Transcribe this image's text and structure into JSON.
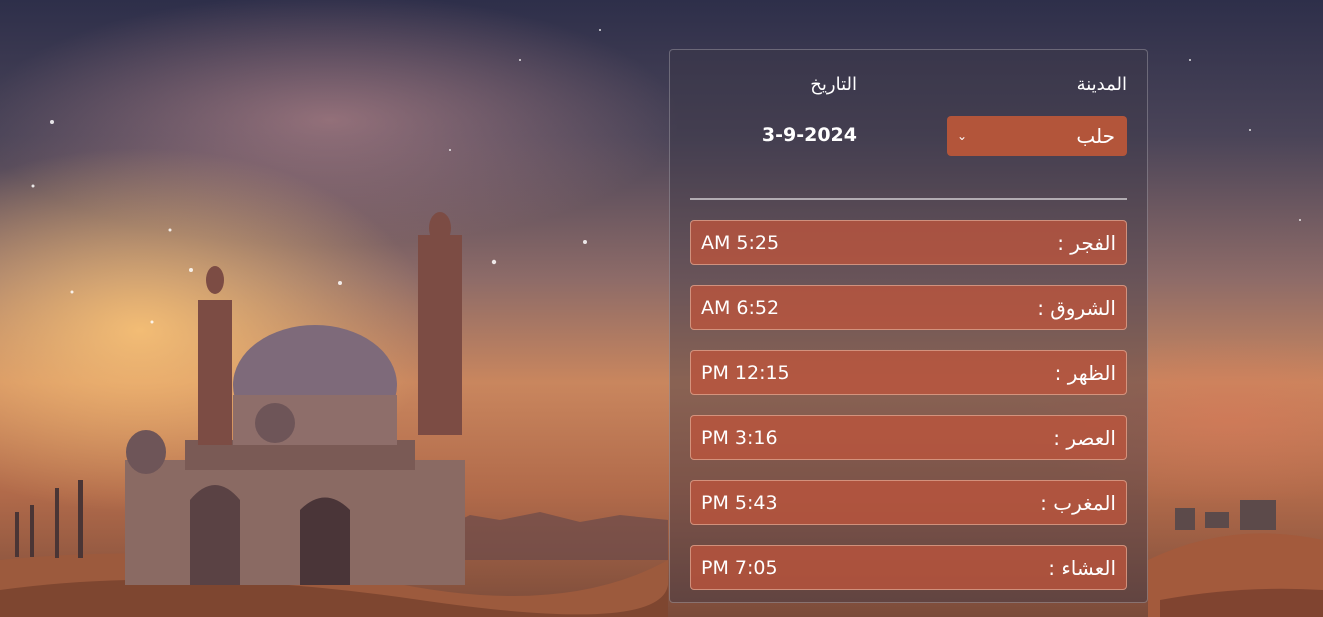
{
  "header": {
    "city_label": "المدينة",
    "date_label": "التاريخ",
    "selected_city": "حلب",
    "date_value": "3-9-2024"
  },
  "prayers": [
    {
      "name": "الفجر :",
      "time": "AM 5:25"
    },
    {
      "name": "الشروق :",
      "time": "AM 6:52"
    },
    {
      "name": "الظهر :",
      "time": "PM 12:15"
    },
    {
      "name": "العصر :",
      "time": "PM 3:16"
    },
    {
      "name": "المغرب :",
      "time": "PM 5:43"
    },
    {
      "name": "العشاء :",
      "time": "PM 7:05"
    }
  ],
  "colors": {
    "accent": "#b3553a",
    "panel_bg": "rgba(60,55,70,0.45)"
  }
}
